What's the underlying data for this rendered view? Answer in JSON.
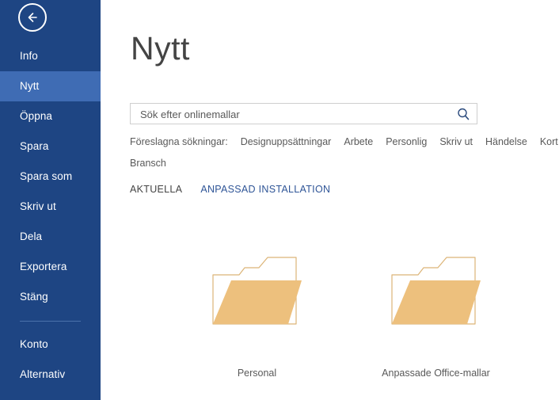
{
  "app": {
    "accent_color": "#1e4583",
    "highlight_color": "#3f6cb4",
    "link_color": "#2f5597",
    "folder_fill_color": "#edc07d",
    "folder_outline_color": "#d9b275"
  },
  "sidebar": {
    "back_button": {
      "icon": "back-arrow-icon",
      "label": "Tillbaka"
    },
    "items": [
      {
        "label": "Info",
        "selected": false
      },
      {
        "label": "Nytt",
        "selected": true
      },
      {
        "label": "Öppna",
        "selected": false
      },
      {
        "label": "Spara",
        "selected": false
      },
      {
        "label": "Spara som",
        "selected": false
      },
      {
        "label": "Skriv ut",
        "selected": false
      },
      {
        "label": "Dela",
        "selected": false
      },
      {
        "label": "Exportera",
        "selected": false
      },
      {
        "label": "Stäng",
        "selected": false
      },
      {
        "label": "Konto",
        "selected": false
      },
      {
        "label": "Alternativ",
        "selected": false
      }
    ]
  },
  "main": {
    "title": "Nytt",
    "search": {
      "placeholder": "Sök efter onlinemallar",
      "value": "",
      "button_icon": "search-icon"
    },
    "suggested": {
      "label": "Föreslagna sökningar:",
      "links": [
        "Designuppsättningar",
        "Arbete",
        "Personlig",
        "Skriv ut",
        "Händelse",
        "Kort",
        "Bransch"
      ]
    },
    "tabs": [
      {
        "label": "AKTUELLA",
        "style": "active"
      },
      {
        "label": "ANPASSAD INSTALLATION",
        "style": "link"
      }
    ],
    "folders": [
      {
        "label": "Personal",
        "icon": "folder-icon"
      },
      {
        "label": "Anpassade Office-mallar",
        "icon": "folder-icon"
      }
    ]
  }
}
